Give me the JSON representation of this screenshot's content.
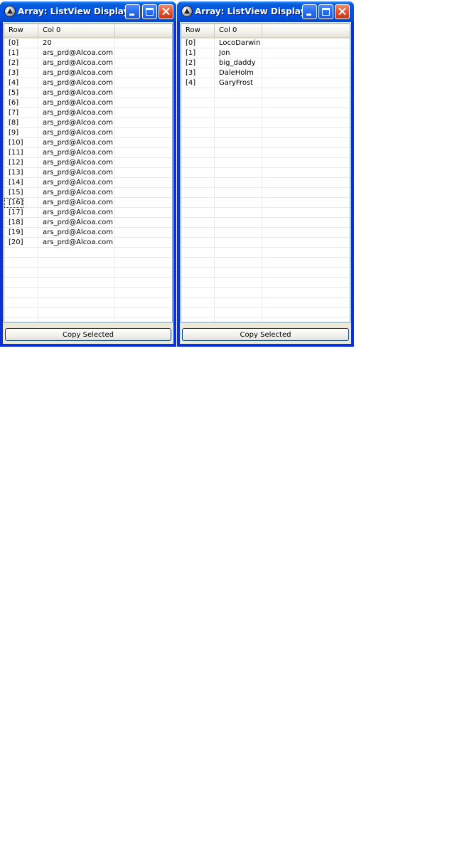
{
  "windows": [
    {
      "title": "Array: ListView Display",
      "columns": [
        "Row",
        "Col 0"
      ],
      "rows": [
        {
          "row": "[0]",
          "col0": "20"
        },
        {
          "row": "[1]",
          "col0": "ars_prd@Alcoa.com"
        },
        {
          "row": "[2]",
          "col0": "ars_prd@Alcoa.com"
        },
        {
          "row": "[3]",
          "col0": "ars_prd@Alcoa.com"
        },
        {
          "row": "[4]",
          "col0": "ars_prd@Alcoa.com"
        },
        {
          "row": "[5]",
          "col0": "ars_prd@Alcoa.com"
        },
        {
          "row": "[6]",
          "col0": "ars_prd@Alcoa.com"
        },
        {
          "row": "[7]",
          "col0": "ars_prd@Alcoa.com"
        },
        {
          "row": "[8]",
          "col0": "ars_prd@Alcoa.com"
        },
        {
          "row": "[9]",
          "col0": "ars_prd@Alcoa.com"
        },
        {
          "row": "[10]",
          "col0": "ars_prd@Alcoa.com"
        },
        {
          "row": "[11]",
          "col0": "ars_prd@Alcoa.com"
        },
        {
          "row": "[12]",
          "col0": "ars_prd@Alcoa.com"
        },
        {
          "row": "[13]",
          "col0": "ars_prd@Alcoa.com"
        },
        {
          "row": "[14]",
          "col0": "ars_prd@Alcoa.com"
        },
        {
          "row": "[15]",
          "col0": "ars_prd@Alcoa.com"
        },
        {
          "row": "[16]",
          "col0": "ars_prd@Alcoa.com"
        },
        {
          "row": "[17]",
          "col0": "ars_prd@Alcoa.com"
        },
        {
          "row": "[18]",
          "col0": "ars_prd@Alcoa.com"
        },
        {
          "row": "[19]",
          "col0": "ars_prd@Alcoa.com"
        },
        {
          "row": "[20]",
          "col0": "ars_prd@Alcoa.com"
        }
      ],
      "focused_row": 16,
      "copy_button": "Copy Selected",
      "icons": {
        "app": "autoit-app-icon",
        "minimize": "minimize-icon",
        "maximize": "maximize-icon",
        "close": "close-icon"
      }
    },
    {
      "title": "Array: ListView Display",
      "columns": [
        "Row",
        "Col 0"
      ],
      "rows": [
        {
          "row": "[0]",
          "col0": "LocoDarwin"
        },
        {
          "row": "[1]",
          "col0": "Jon"
        },
        {
          "row": "[2]",
          "col0": "big_daddy"
        },
        {
          "row": "[3]",
          "col0": "DaleHolm"
        },
        {
          "row": "[4]",
          "col0": "GaryFrost"
        }
      ],
      "focused_row": null,
      "copy_button": "Copy Selected",
      "icons": {
        "app": "autoit-app-icon",
        "minimize": "minimize-icon",
        "maximize": "maximize-icon",
        "close": "close-icon"
      }
    }
  ],
  "colors": {
    "titlebar": "#0054e3",
    "window_frame": "#0831d9",
    "client_background": "#ece9d8",
    "close_button": "#e05a36"
  }
}
